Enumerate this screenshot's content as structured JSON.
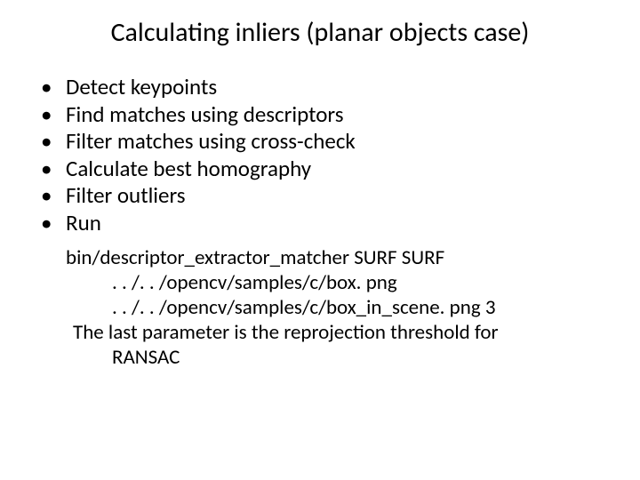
{
  "title": "Calculating inliers (planar objects case)",
  "bullets": [
    "Detect keypoints",
    "Find matches using descriptors",
    "Filter matches using cross-check",
    "Calculate best homography",
    "Filter outliers",
    "Run"
  ],
  "code": {
    "line1": "bin/descriptor_extractor_matcher SURF SURF",
    "line2": ". . /. . /opencv/samples/c/box. png",
    "line3": ". . /. . /opencv/samples/c/box_in_scene. png 3",
    "note1": "The last parameter is the reprojection threshold for",
    "note2": "RANSAC"
  }
}
